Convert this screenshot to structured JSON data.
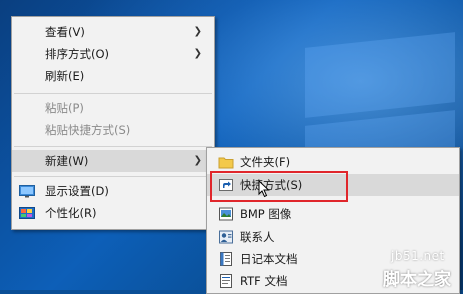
{
  "context_menu": {
    "items": [
      {
        "label": "查看(V)",
        "has_submenu": true,
        "disabled": false
      },
      {
        "label": "排序方式(O)",
        "has_submenu": true,
        "disabled": false
      },
      {
        "label": "刷新(E)",
        "has_submenu": false,
        "disabled": false
      },
      {
        "label": "粘贴(P)",
        "has_submenu": false,
        "disabled": true
      },
      {
        "label": "粘贴快捷方式(S)",
        "has_submenu": false,
        "disabled": true
      },
      {
        "label": "新建(W)",
        "has_submenu": true,
        "disabled": false,
        "highlighted": true
      },
      {
        "label": "显示设置(D)",
        "icon": "display-settings-icon"
      },
      {
        "label": "个性化(R)",
        "icon": "personalize-icon"
      }
    ]
  },
  "new_submenu": {
    "items": [
      {
        "label": "文件夹(F)",
        "icon": "folder-icon"
      },
      {
        "label": "快捷方式(S)",
        "icon": "shortcut-icon",
        "highlighted": true
      },
      {
        "label": "BMP 图像",
        "icon": "bitmap-image-icon"
      },
      {
        "label": "联系人",
        "icon": "contact-icon"
      },
      {
        "label": "日记本文档",
        "icon": "journal-document-icon"
      },
      {
        "label": "RTF 文档",
        "icon": "rtf-document-icon"
      }
    ]
  },
  "watermark": {
    "line1": "jb51.net",
    "line2": "脚本之家"
  },
  "colors": {
    "highlight_box": "#e0262b",
    "menu_background": "#f2f2f2",
    "desktop_blue": "#0d5fb8"
  }
}
